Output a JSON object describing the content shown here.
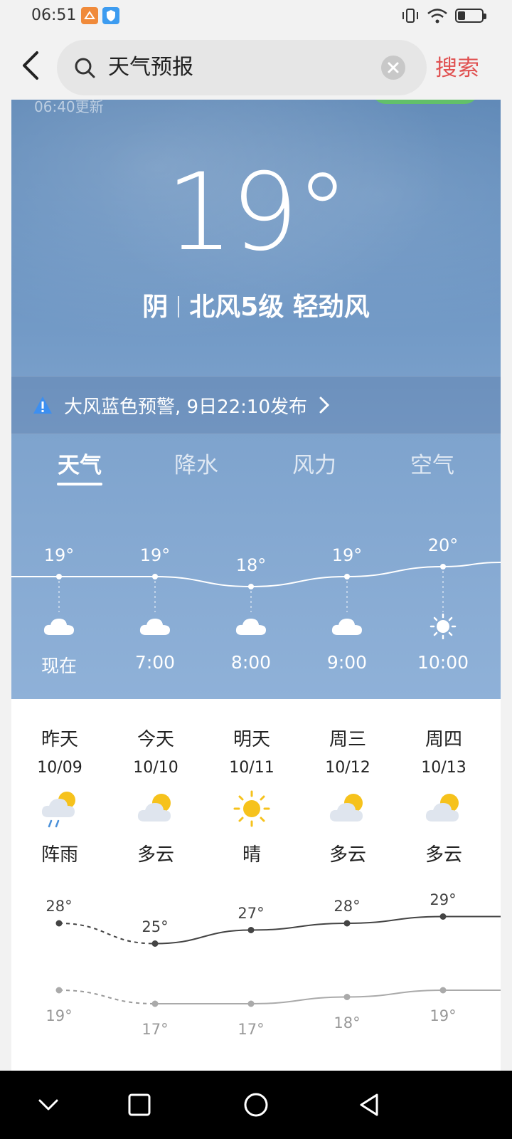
{
  "status_bar": {
    "time": "06:51"
  },
  "search": {
    "back_icon": "chevron-left-icon",
    "query": "天气预报",
    "action_label": "搜索",
    "action_color": "#e05050"
  },
  "weather": {
    "updated": "06:40更新",
    "temperature": "19°",
    "condition": "阴",
    "wind": "北风5级 轻劲风",
    "alert": "大风蓝色预警, 9日22:10发布",
    "alert_color": "#3d8ff0",
    "tabs": [
      {
        "label": "天气",
        "active": true
      },
      {
        "label": "降水",
        "active": false
      },
      {
        "label": "风力",
        "active": false
      },
      {
        "label": "空气",
        "active": false
      }
    ],
    "hourly": [
      {
        "time": "现在",
        "temp": "19°",
        "value": 19,
        "icon": "cloud-icon"
      },
      {
        "time": "7:00",
        "temp": "19°",
        "value": 19,
        "icon": "cloud-icon"
      },
      {
        "time": "8:00",
        "temp": "18°",
        "value": 18,
        "icon": "cloud-icon"
      },
      {
        "time": "9:00",
        "temp": "19°",
        "value": 19,
        "icon": "cloud-icon"
      },
      {
        "time": "10:00",
        "temp": "20°",
        "value": 20,
        "icon": "sun-icon"
      }
    ]
  },
  "daily": [
    {
      "day": "昨天",
      "date": "10/09",
      "condition": "阵雨",
      "icon": "shower-icon",
      "high": "28°",
      "low": "19°",
      "high_value": 28,
      "low_value": 19
    },
    {
      "day": "今天",
      "date": "10/10",
      "condition": "多云",
      "icon": "partly-cloudy-icon",
      "high": "25°",
      "low": "17°",
      "high_value": 25,
      "low_value": 17
    },
    {
      "day": "明天",
      "date": "10/11",
      "condition": "晴",
      "icon": "sunny-icon",
      "high": "27°",
      "low": "17°",
      "high_value": 27,
      "low_value": 17
    },
    {
      "day": "周三",
      "date": "10/12",
      "condition": "多云",
      "icon": "partly-cloudy-icon",
      "high": "28°",
      "low": "18°",
      "high_value": 28,
      "low_value": 18
    },
    {
      "day": "周四",
      "date": "10/13",
      "condition": "多云",
      "icon": "partly-cloudy-icon",
      "high": "29°",
      "low": "19°",
      "high_value": 29,
      "low_value": 19
    }
  ],
  "nav": [
    "chevron-down-icon",
    "square-icon",
    "circle-icon",
    "triangle-back-icon"
  ]
}
